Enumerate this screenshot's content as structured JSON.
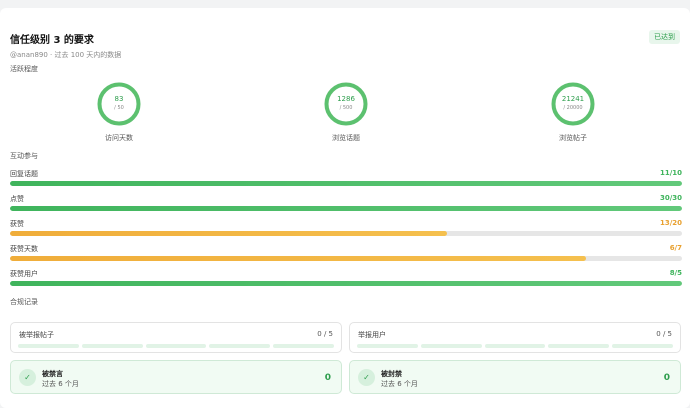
{
  "header": {
    "title": "信任级别 3 的要求",
    "subtitle": "@anan890 · 过去 100 天内的数据",
    "badge": "已达到"
  },
  "activity": {
    "section_label": "活跃程度",
    "rings": [
      {
        "value": "83",
        "target": "/ 50",
        "label": "访问天数",
        "progress": 1.0
      },
      {
        "value": "1286",
        "target": "/ 500",
        "label": "浏览话题",
        "progress": 1.0
      },
      {
        "value": "21241",
        "target": "/ 20000",
        "label": "浏览帖子",
        "progress": 1.0
      }
    ]
  },
  "interaction": {
    "section_label": "互动参与",
    "bars": [
      {
        "label": "回复话题",
        "value": "11/10",
        "progress": 1.0,
        "status": "met"
      },
      {
        "label": "点赞",
        "value": "30/30",
        "progress": 1.0,
        "status": "met"
      },
      {
        "label": "获赞",
        "value": "13/20",
        "progress": 0.65,
        "status": "unmet"
      },
      {
        "label": "获赞天数",
        "value": "6/7",
        "progress": 0.857,
        "status": "unmet"
      },
      {
        "label": "获赞用户",
        "value": "8/5",
        "progress": 1.0,
        "status": "met"
      }
    ]
  },
  "compliance": {
    "section_label": "合规记录",
    "reports": [
      {
        "label": "被举报帖子",
        "count": "0 / 5"
      },
      {
        "label": "举报用户",
        "count": "0 / 5"
      }
    ],
    "statuses": [
      {
        "title": "被禁言",
        "sub": "过去 6 个月",
        "count": "0"
      },
      {
        "title": "被封禁",
        "sub": "过去 6 个月",
        "count": "0"
      }
    ]
  },
  "colors": {
    "met": "#3fb45c",
    "unmet": "#f0ad3a"
  }
}
